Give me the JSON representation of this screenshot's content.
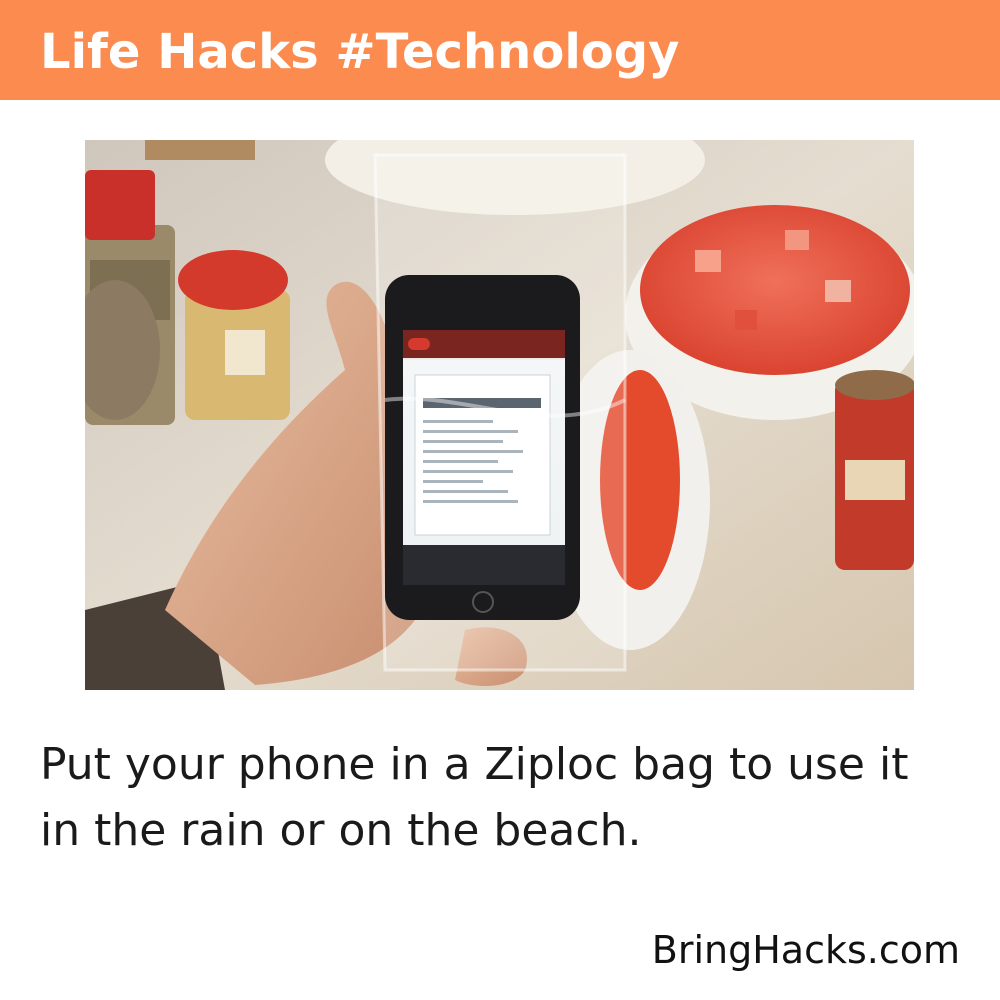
{
  "header": {
    "title": "Life Hacks #Technology"
  },
  "caption": {
    "text": "Put your phone in a Ziploc bag to use it in the rain or on the beach."
  },
  "footer": {
    "brand": "BringHacks.com"
  },
  "colors": {
    "header_bg": "#fc8b4f",
    "header_text": "#ffffff",
    "body_text": "#1a1a1a"
  }
}
